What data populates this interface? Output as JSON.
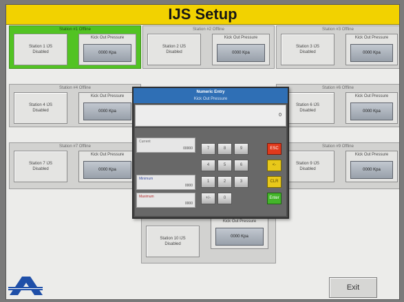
{
  "app": {
    "title": "IJS Setup"
  },
  "stations": [
    {
      "title": "Station #1 Offline",
      "status_line1": "Station 1 IJS",
      "status_line2": "Disabled",
      "pressure_label": "Kick Out Pressure",
      "pressure_value": "0000 Kpa",
      "active": true
    },
    {
      "title": "Station #2 Offline",
      "status_line1": "Station 2 IJS",
      "status_line2": "Disabled",
      "pressure_label": "Kick Out Pressure",
      "pressure_value": "0000 Kpa",
      "active": false
    },
    {
      "title": "Station #3 Offline",
      "status_line1": "Station 3 IJS",
      "status_line2": "Disabled",
      "pressure_label": "Kick Out Pressure",
      "pressure_value": "0000 Kpa",
      "active": false
    },
    {
      "title": "Station #4 Offline",
      "status_line1": "Station 4 IJS",
      "status_line2": "Disabled",
      "pressure_label": "Kick Out Pressure",
      "pressure_value": "0000 Kpa",
      "active": false
    },
    {
      "title": "Station #6 Offline",
      "status_line1": "Station 6 IJS",
      "status_line2": "Disabled",
      "pressure_label": "Kick Out Pressure",
      "pressure_value": "0000 Kpa",
      "active": false
    },
    {
      "title": "Station #7 Offline",
      "status_line1": "Station 7 IJS",
      "status_line2": "Disabled",
      "pressure_label": "Kick Out Pressure",
      "pressure_value": "0000 Kpa",
      "active": false
    },
    {
      "title": "Station #9 Offline",
      "status_line1": "Station 9 IJS",
      "status_line2": "Disabled",
      "pressure_label": "Kick Out Pressure",
      "pressure_value": "0000 Kpa",
      "active": false
    },
    {
      "title": "",
      "status_line1": "Station 10 IJS",
      "status_line2": "Disabled",
      "pressure_label": "Kick Out Pressure",
      "pressure_value": "0000 Kpa",
      "active": false
    }
  ],
  "dialog": {
    "title": "Numeric Entry",
    "subtitle": "Kick Out Pressure",
    "display_value": "0",
    "current": {
      "label": "Current",
      "value": "00000"
    },
    "minimum": {
      "label": "Minimum",
      "value": "0000"
    },
    "maximum": {
      "label": "Maximum",
      "value": "0000"
    },
    "keys": {
      "k7": "7",
      "k8": "8",
      "k9": "9",
      "esc": "ESC",
      "k4": "4",
      "k5": "5",
      "k6": "6",
      "bs": "<-",
      "k1": "1",
      "k2": "2",
      "k3": "3",
      "clr": "CLR",
      "neg": "+/-",
      "k0": "0",
      "ent": "Enter"
    }
  },
  "exit_label": "Exit",
  "colors": {
    "title_bar": "#f2d200",
    "active_station": "#52c323",
    "dialog_header": "#2f6fb5",
    "esc_key": "#e0391b",
    "yellow_key": "#e8c81a",
    "enter_key": "#44b52a",
    "logo": "#1f4fa8"
  },
  "icons": {
    "logo": "company-logo-a"
  }
}
